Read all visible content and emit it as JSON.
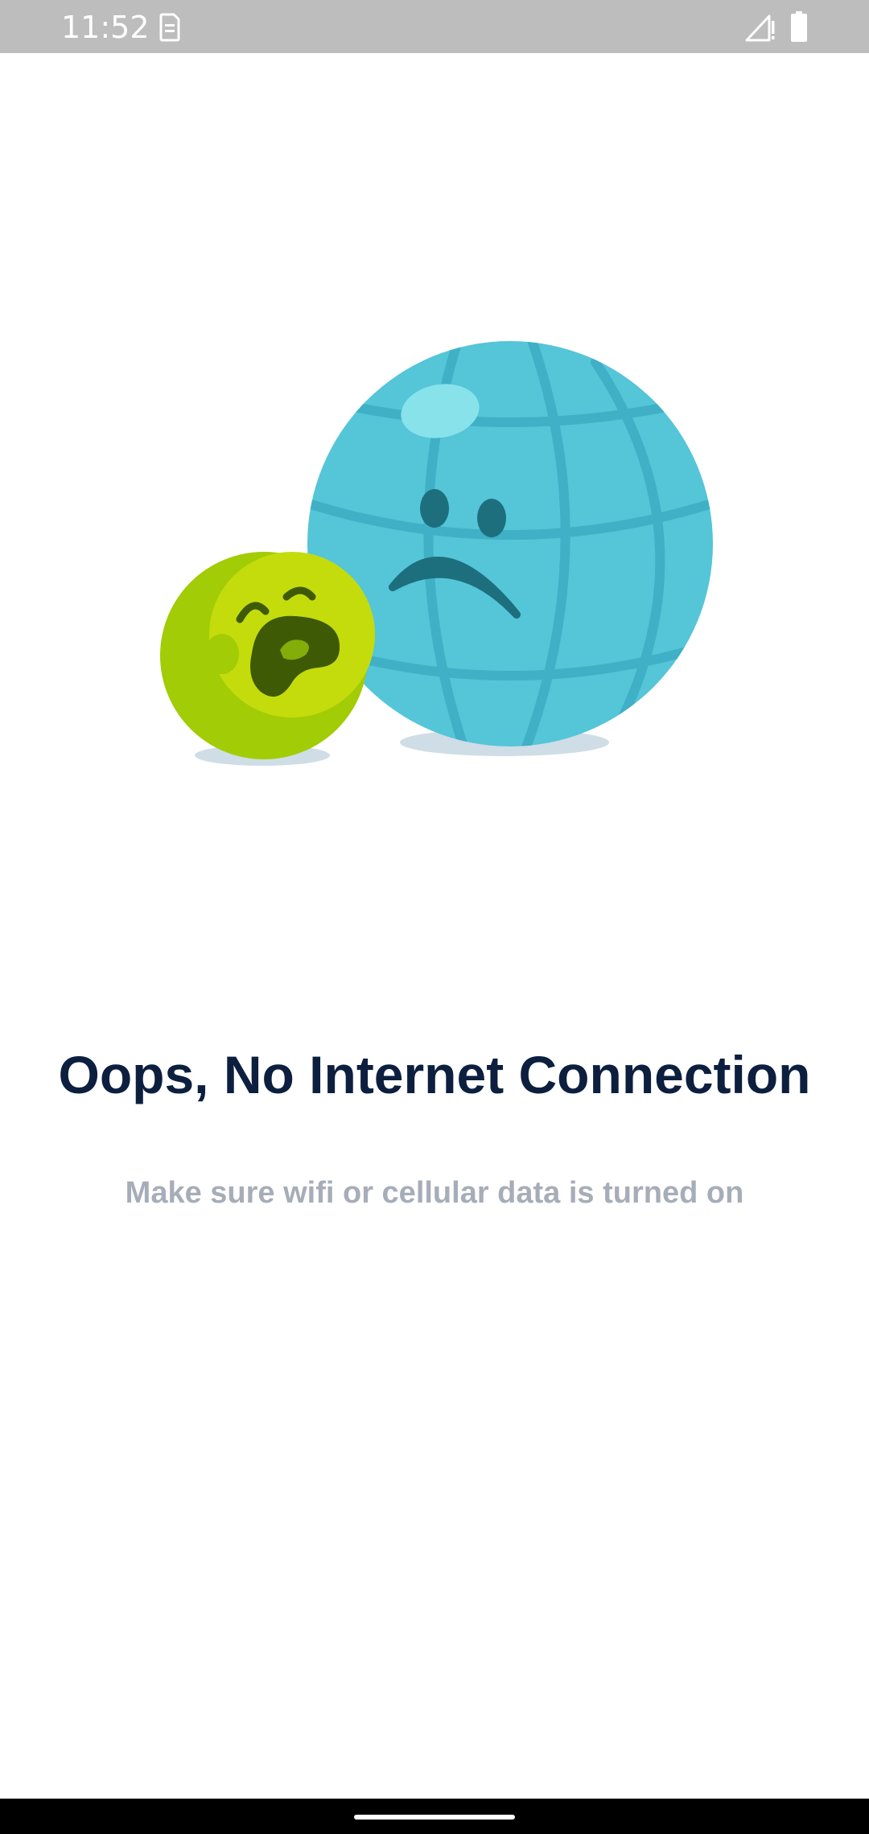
{
  "status_bar": {
    "time": "11:52",
    "notification_icon": "sim-notification-icon",
    "signal_icon": "signal-no-service-icon",
    "battery_icon": "battery-full-icon",
    "background_color": "#bdbdbd"
  },
  "illustration": {
    "icons": [
      "sad-globe-icon",
      "crying-ball-icon"
    ],
    "globe_color": "#55c5d8",
    "ball_color": "#a2cc05"
  },
  "message": {
    "title": "Oops, No Internet Connection",
    "subtitle": "Make sure wifi or cellular data is turned on",
    "title_color": "#0c1f3f",
    "subtitle_color": "#a7adb8"
  }
}
